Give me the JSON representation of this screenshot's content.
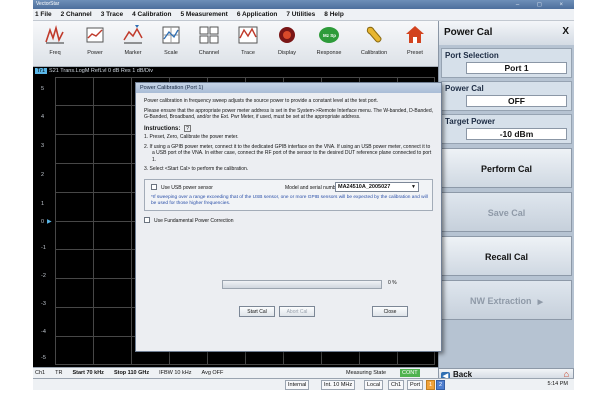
{
  "window": {
    "title": "VectorStar",
    "controls": "– ◻ ×"
  },
  "menu": [
    "1 File",
    "2 Channel",
    "3 Trace",
    "4 Calibration",
    "5 Measurement",
    "6 Application",
    "7 Utilities",
    "8 Help"
  ],
  "toolbar": {
    "freq": "Freq",
    "power": "Power",
    "marker": "Marker",
    "scale": "Scale",
    "channel": "Channel",
    "trace": "Trace",
    "display": "Display",
    "response": "Response",
    "calibration": "Calibration",
    "preset": "Preset",
    "response_badge": "Mz Sp"
  },
  "graph": {
    "trace_id": "Tr1",
    "trace_header": "S21 Trans.LogM RefLvl 0 dB Res 1 dB/Div",
    "y_labels": [
      "5",
      "4",
      "3",
      "2",
      "1",
      "0",
      "-1",
      "-2",
      "-3",
      "-4",
      "-5"
    ]
  },
  "dialog": {
    "title": "Power Calibration (Port 1)",
    "para1": "Power calibration in frequency sweep adjusts the source power to provide a constant level at the test port.",
    "para2": "Please ensure that the appropriate power meter address is set in the System->Remote Interface menu. The W-banded, D-Banded, G-Banded, Broadband, and/or the Ext. Pwr Meter, if used, must be set at the appropriate address.",
    "instructions_label": "Instructions:",
    "steps": [
      "1.  Preset, Zero, Calibrate the power meter.",
      "2.  If using a GPIB power meter, connect it to the dedicated GPIB interface on the VNA.  If using an USB power meter, connect it to a USB port of the VNA.  In either case, connect the RF port of the sensor to the desired DUT reference plane connected to port 1.",
      "3.  Select <Start Cal> to perform the calibration."
    ],
    "use_usb_label": "Use USB power sensor",
    "model_label": "Model and serial number",
    "model_value": "MA24510A_2005027",
    "usb_warning": "*If sweeping over a range exceeding that of the USB sensor, one or more GPIB sensors will be expected by the calibration and will be used for those higher frequencies.",
    "fundamental_label": "Use Fundamental Power Correction",
    "progress_percent": 0,
    "progress_text": "0 %",
    "start_cal": "Start Cal",
    "abort_cal": "Abort Cal",
    "close": "Close"
  },
  "right_panel": {
    "title": "Power Cal",
    "close": "X",
    "port_selection_label": "Port Selection",
    "port_selection_value": "Port 1",
    "power_cal_label": "Power Cal",
    "power_cal_value": "OFF",
    "target_power_label": "Target Power",
    "target_power_value": "-10 dBm",
    "perform_cal": "Perform Cal",
    "save_cal": "Save Cal",
    "recall_cal": "Recall Cal",
    "nw_extraction": "NW Extraction",
    "back": "Back"
  },
  "status": {
    "ch": "Ch1",
    "tr": "TR",
    "start": "Start 70 kHz",
    "stop": "Stop 110 GHz",
    "ifbw": "IFBW 10 kHz",
    "avg": "Avg OFF",
    "measuring_state": "Measuring State",
    "cont": "CONT",
    "internal": "Internal",
    "int_ref": "Int. 10 MHz",
    "local": "Local",
    "ch1": "Ch1",
    "port": "Port",
    "port1": "1",
    "port2": "2",
    "time": "5:14 PM"
  },
  "colors": {
    "graph_bg": "#000000",
    "trace_blue": "#5ab7e8",
    "cont_green": "#4fb34f",
    "port_orange": "#f0a33b",
    "port_blue": "#4f7fcf"
  }
}
